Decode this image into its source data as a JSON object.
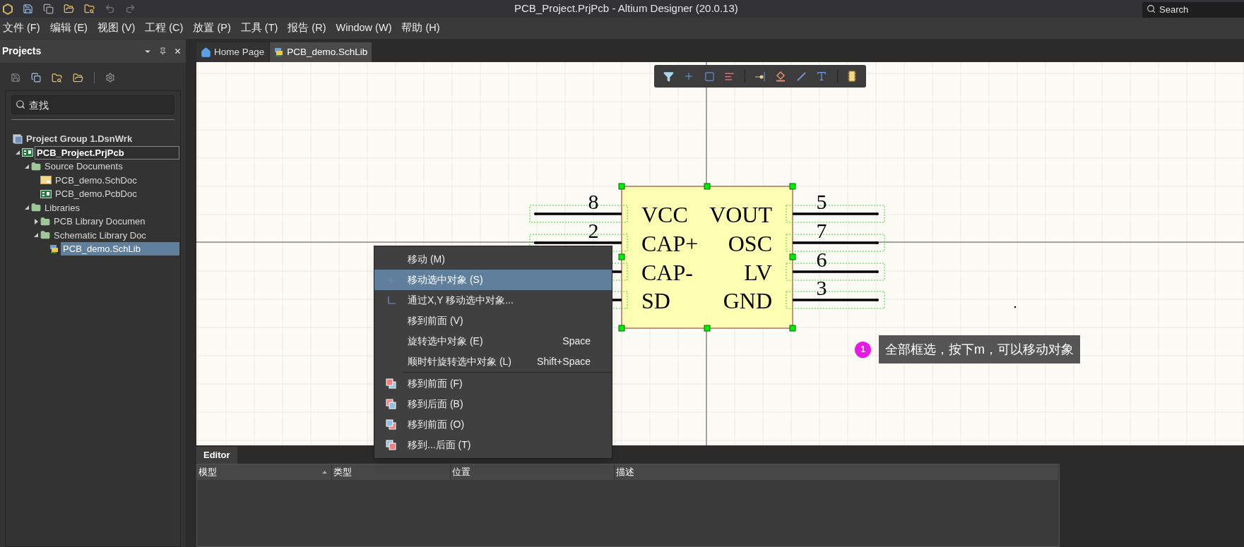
{
  "title_bar": {
    "title": "PCB_Project.PrjPcb - Altium Designer (20.0.13)",
    "search_placeholder": "Search"
  },
  "menu": [
    "文件 (F)",
    "编辑 (E)",
    "视图 (V)",
    "工程 (C)",
    "放置 (P)",
    "工具 (T)",
    "报告 (R)",
    "Window (W)",
    "帮助 (H)"
  ],
  "projects_panel": {
    "title": "Projects",
    "search_placeholder": "查找",
    "tree": [
      {
        "label": "Project Group 1.DsnWrk",
        "kind": "group",
        "selected": false,
        "focused": false,
        "children": [
          {
            "label": "PCB_Project.PrjPcb",
            "kind": "project",
            "selected": false,
            "focused": true,
            "expanded": true,
            "children": [
              {
                "label": "Source Documents",
                "kind": "folder",
                "selected": false,
                "focused": false,
                "expanded": true,
                "children": [
                  {
                    "label": "PCB_demo.SchDoc",
                    "kind": "schdoc",
                    "selected": false,
                    "focused": false
                  },
                  {
                    "label": "PCB_demo.PcbDoc",
                    "kind": "pcbdoc",
                    "selected": false,
                    "focused": false
                  }
                ]
              },
              {
                "label": "Libraries",
                "kind": "folder",
                "selected": false,
                "focused": false,
                "expanded": true,
                "children": [
                  {
                    "label": "PCB Library Documen",
                    "kind": "folder",
                    "selected": false,
                    "focused": false,
                    "expanded": false
                  },
                  {
                    "label": "Schematic Library Doc",
                    "kind": "folder",
                    "selected": false,
                    "focused": false,
                    "expanded": true,
                    "children": [
                      {
                        "label": "PCB_demo.SchLib",
                        "kind": "schlib",
                        "selected": true,
                        "focused": false
                      }
                    ]
                  }
                ]
              }
            ]
          }
        ]
      }
    ]
  },
  "tabs": [
    {
      "label": "Home Page",
      "kind": "home",
      "selected": false
    },
    {
      "label": "PCB_demo.SchLib",
      "kind": "schlib",
      "selected": true
    }
  ],
  "symbol": {
    "left_pins": [
      {
        "number": "8",
        "name": "VCC"
      },
      {
        "number": "2",
        "name": "CAP+"
      },
      {
        "name": "CAP-"
      },
      {
        "name": "SD"
      }
    ],
    "right_pins": [
      {
        "number": "5",
        "name": "VOUT"
      },
      {
        "number": "7",
        "name": "OSC"
      },
      {
        "number": "6",
        "name": "LV"
      },
      {
        "number": "3",
        "name": "GND"
      }
    ]
  },
  "context_menu": {
    "groups": [
      [
        {
          "label": "移动 (M)",
          "selected": false
        },
        {
          "label": "移动选中对象 (S)",
          "selected": true
        },
        {
          "label": "通过X,Y 移动选中对象...",
          "selected": false
        },
        {
          "label": "移到前面 (V)",
          "selected": false
        },
        {
          "label": "旋转选中对象 (E)",
          "shortcut": "Space",
          "selected": false
        },
        {
          "label": "顺时针旋转选中对象 (L)",
          "shortcut": "Shift+Space",
          "selected": false
        }
      ],
      [
        {
          "label": "移到前面 (F)",
          "selected": false
        },
        {
          "label": "移到后面 (B)",
          "selected": false
        },
        {
          "label": "移到前面 (O)",
          "selected": false
        },
        {
          "label": "移到...后面 (T)",
          "selected": false
        }
      ]
    ]
  },
  "annotation": {
    "number": "1",
    "text": "全部框选，按下m，可以移动对象"
  },
  "editor_panel": {
    "tab": "Editor",
    "columns": [
      "模型",
      "类型",
      "位置",
      "描述"
    ]
  }
}
